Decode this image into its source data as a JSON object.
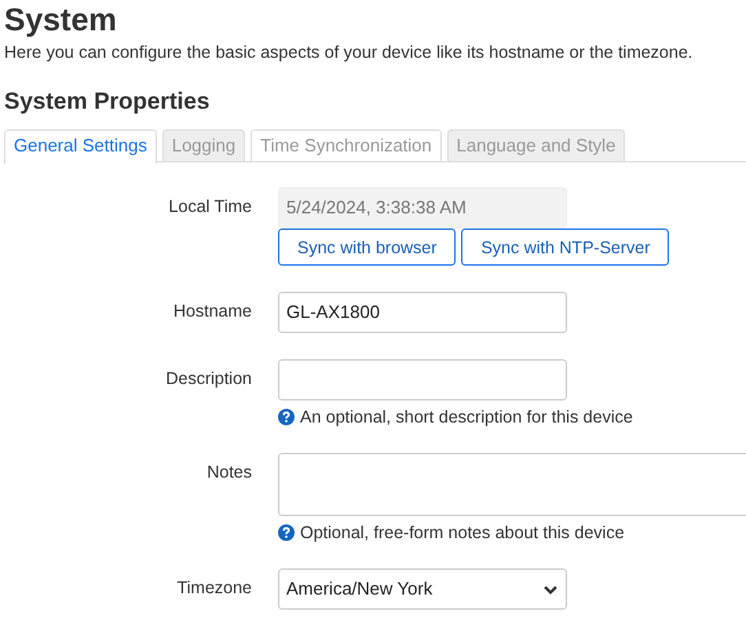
{
  "title": "System",
  "intro": "Here you can configure the basic aspects of your device like its hostname or the timezone.",
  "section_title": "System Properties",
  "tabs": [
    {
      "label": "General Settings",
      "selected": true,
      "hovered": false
    },
    {
      "label": "Logging",
      "selected": false,
      "hovered": false
    },
    {
      "label": "Time Synchronization",
      "selected": false,
      "hovered": true
    },
    {
      "label": "Language and Style",
      "selected": false,
      "hovered": false
    }
  ],
  "fields": [
    {
      "kind": "readonly",
      "label": "Local Time",
      "value": "5/24/2024, 3:38:38 AM",
      "buttons": [
        "Sync with browser",
        "Sync with NTP-Server"
      ]
    },
    {
      "kind": "text",
      "label": "Hostname",
      "value": "GL-AX1800"
    },
    {
      "kind": "text",
      "label": "Description",
      "help": "An optional, short description for this device"
    },
    {
      "kind": "textarea",
      "label": "Notes",
      "help": "Optional, free-form notes about this device"
    },
    {
      "kind": "select",
      "label": "Timezone",
      "value": "America/New York"
    }
  ]
}
